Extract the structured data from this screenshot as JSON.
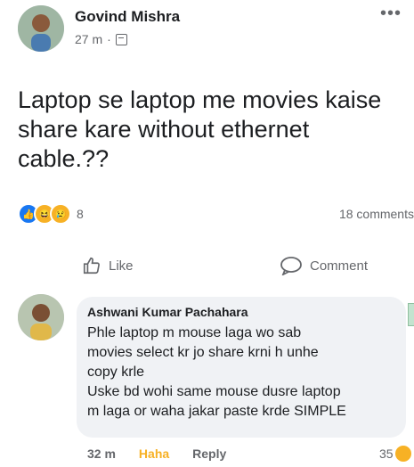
{
  "post": {
    "author": "Govind Mishra",
    "time": "27 m",
    "separator": "·",
    "audience_icon": "public-icon",
    "text": "Laptop se laptop me movies kaise share kare without ethernet cable.??",
    "reactions": [
      "like",
      "haha",
      "sad"
    ],
    "reaction_count": "8",
    "comment_count": "18 comments"
  },
  "actions": {
    "like_label": "Like",
    "comment_label": "Comment"
  },
  "comment": {
    "author": "Ashwani Kumar Pachahara",
    "lines": [
      "Phle laptop m mouse laga wo sab",
      "movies select kr jo share krni h unhe",
      "copy krle",
      "Uske bd wohi same mouse dusre laptop",
      "m laga or waha jakar paste krde SIMPLE"
    ],
    "time": "32 m",
    "haha_label": "Haha",
    "reply_label": "Reply",
    "reaction_count": "35"
  },
  "colors": {
    "accent": "#1877f2",
    "haha": "#f7b125",
    "muted": "#65676b",
    "bubble": "#f0f2f5"
  }
}
